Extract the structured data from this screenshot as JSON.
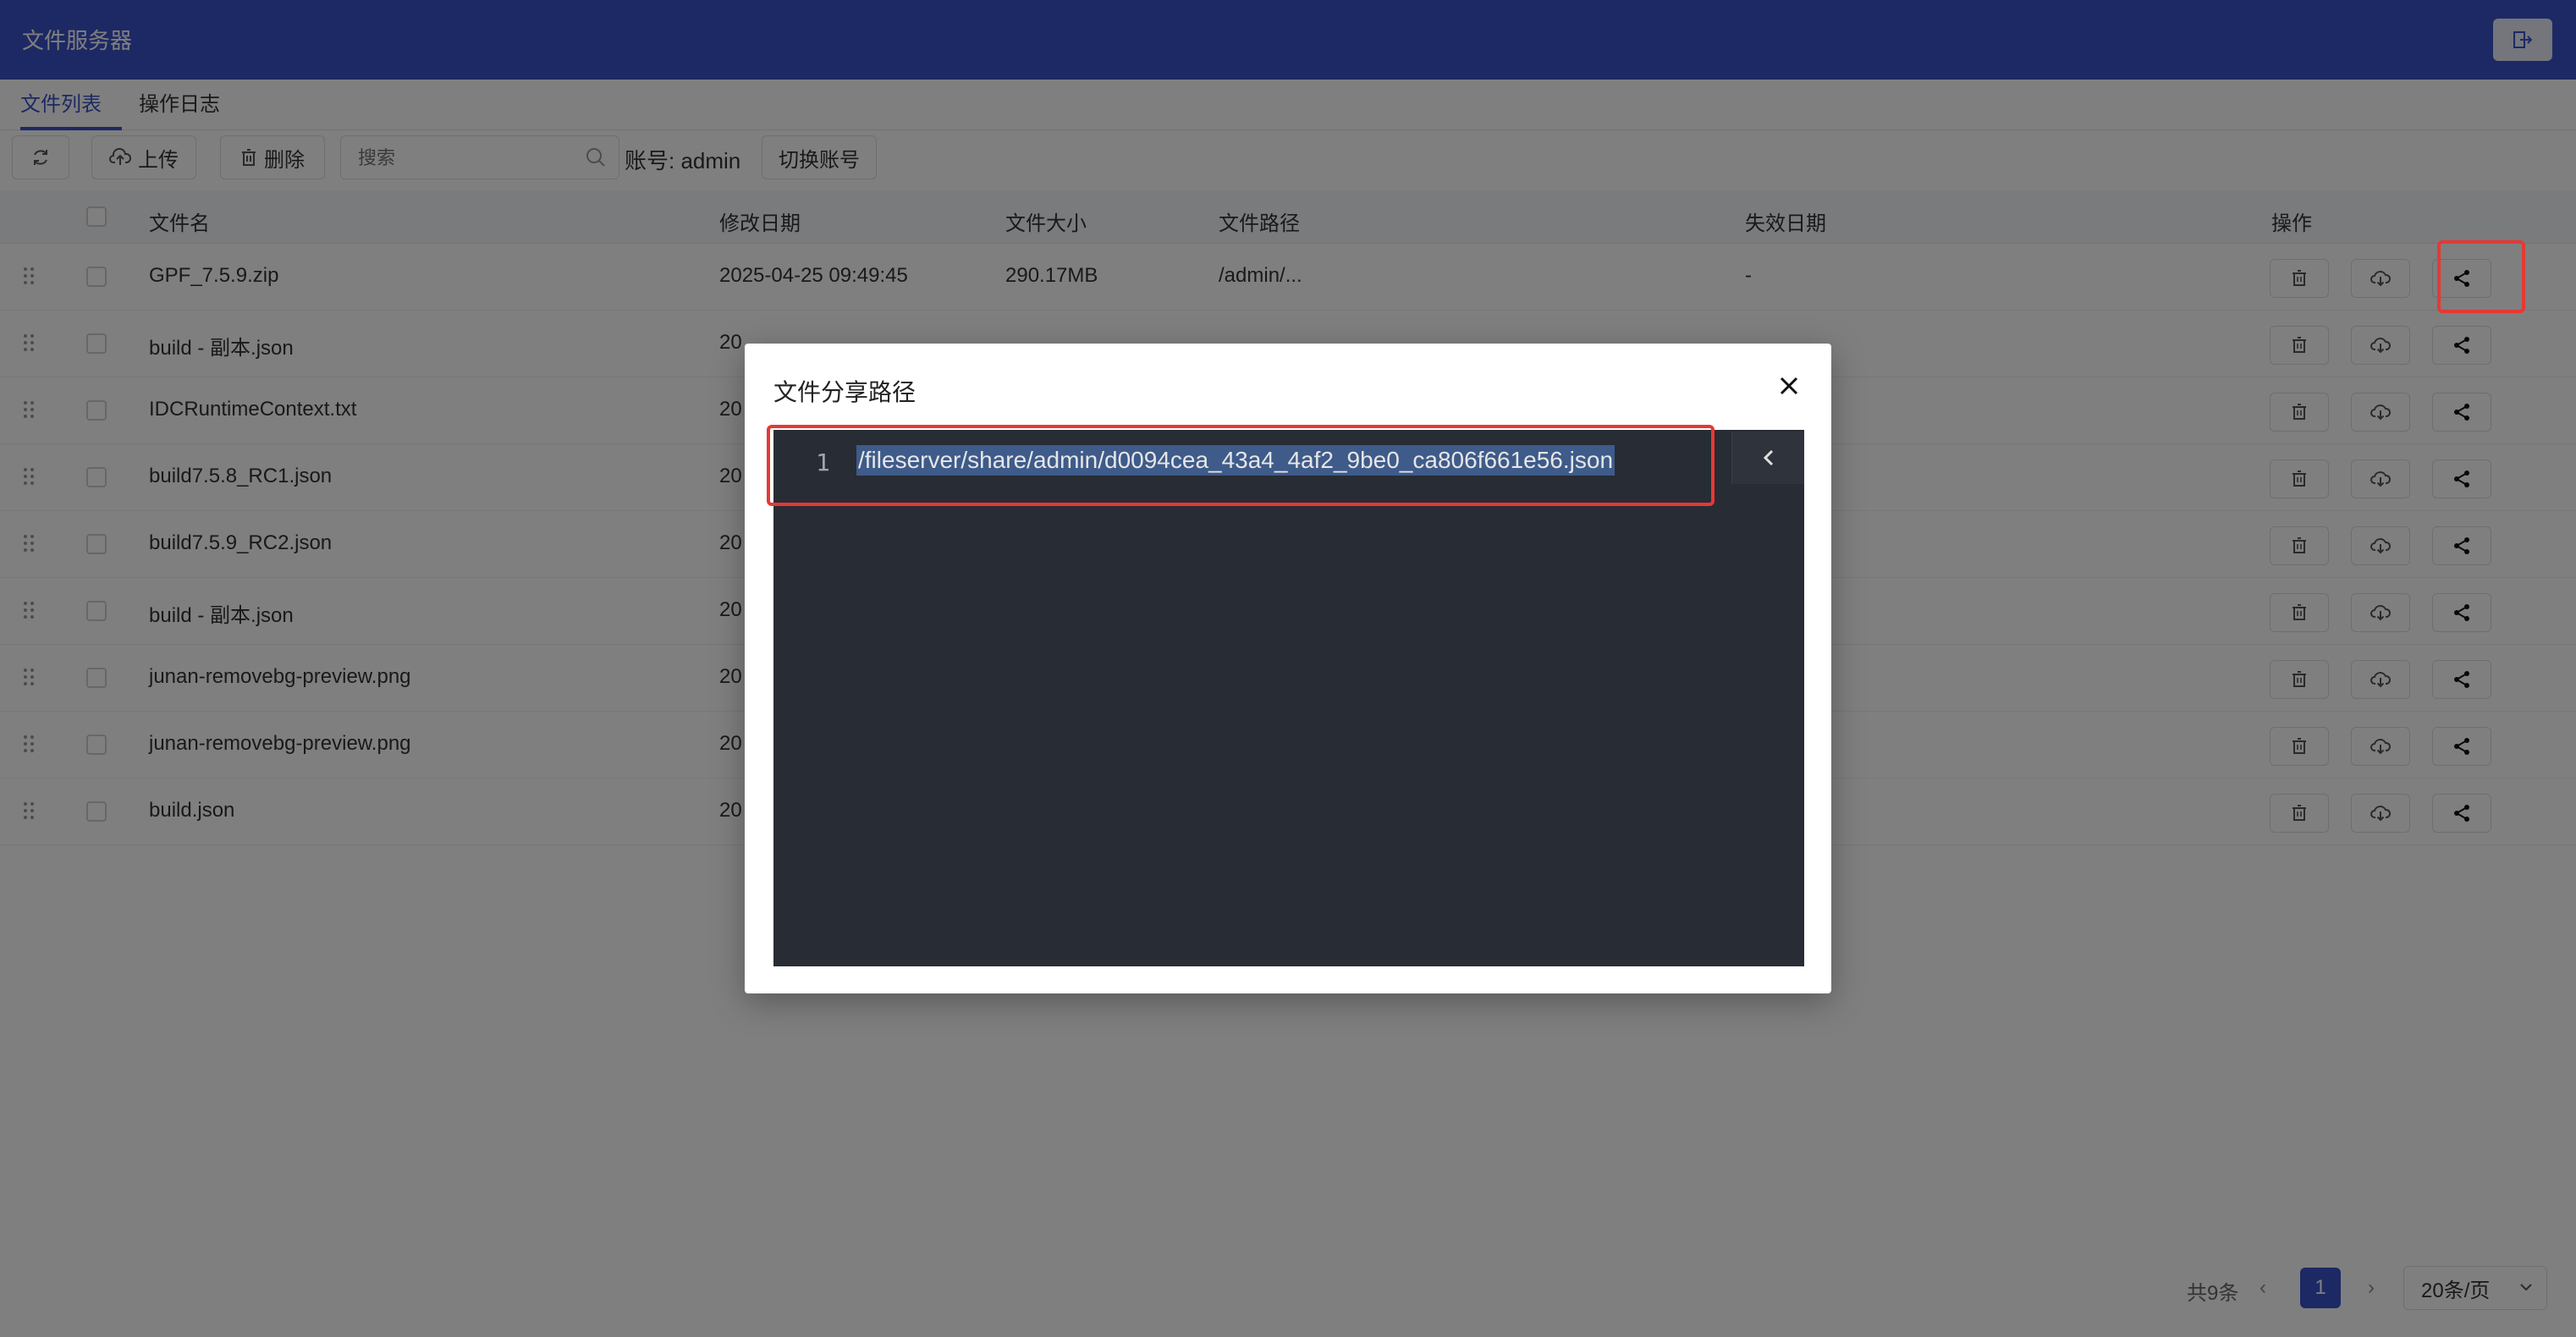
{
  "header": {
    "title": "文件服务器",
    "logout_icon": "logout-icon"
  },
  "tabs": [
    {
      "label": "文件列表",
      "active": true
    },
    {
      "label": "操作日志",
      "active": false
    }
  ],
  "toolbar": {
    "refresh_icon": "refresh-icon",
    "upload_label": "上传",
    "delete_label": "删除",
    "search_placeholder": "搜索",
    "account_label": "账号: admin",
    "switch_account_label": "切换账号"
  },
  "table": {
    "columns": [
      "文件名",
      "修改日期",
      "文件大小",
      "文件路径",
      "失效日期",
      "操作"
    ],
    "rows": [
      {
        "name": "GPF_7.5.9.zip",
        "modified": "2025-04-25 09:49:45",
        "size": "290.17MB",
        "path": "/admin/...",
        "expires": "-"
      },
      {
        "name": "build - 副本.json",
        "modified": "20",
        "size": "",
        "path": "",
        "expires": ""
      },
      {
        "name": "IDCRuntimeContext.txt",
        "modified": "20",
        "size": "",
        "path": "",
        "expires": ""
      },
      {
        "name": "build7.5.8_RC1.json",
        "modified": "20",
        "size": "",
        "path": "",
        "expires": ""
      },
      {
        "name": "build7.5.9_RC2.json",
        "modified": "20",
        "size": "",
        "path": "",
        "expires": ""
      },
      {
        "name": "build - 副本.json",
        "modified": "20",
        "size": "",
        "path": "",
        "expires": ""
      },
      {
        "name": "junan-removebg-preview.png",
        "modified": "20",
        "size": "",
        "path": "",
        "expires": ""
      },
      {
        "name": "junan-removebg-preview.png",
        "modified": "20",
        "size": "",
        "path": "",
        "expires": ""
      },
      {
        "name": "build.json",
        "modified": "20",
        "size": "",
        "path": "",
        "expires": ""
      }
    ]
  },
  "pagination": {
    "total": "共9条",
    "current_page": "1",
    "page_size": "20条/页"
  },
  "modal": {
    "title": "文件分享路径",
    "line_number": "1",
    "share_path": "/fileserver/share/admin/d0094cea_43a4_4af2_9be0_ca806f661e56.json"
  },
  "colors": {
    "header_bg": "#3a52c8",
    "highlight": "#e53935",
    "editor_bg": "#282c34"
  }
}
